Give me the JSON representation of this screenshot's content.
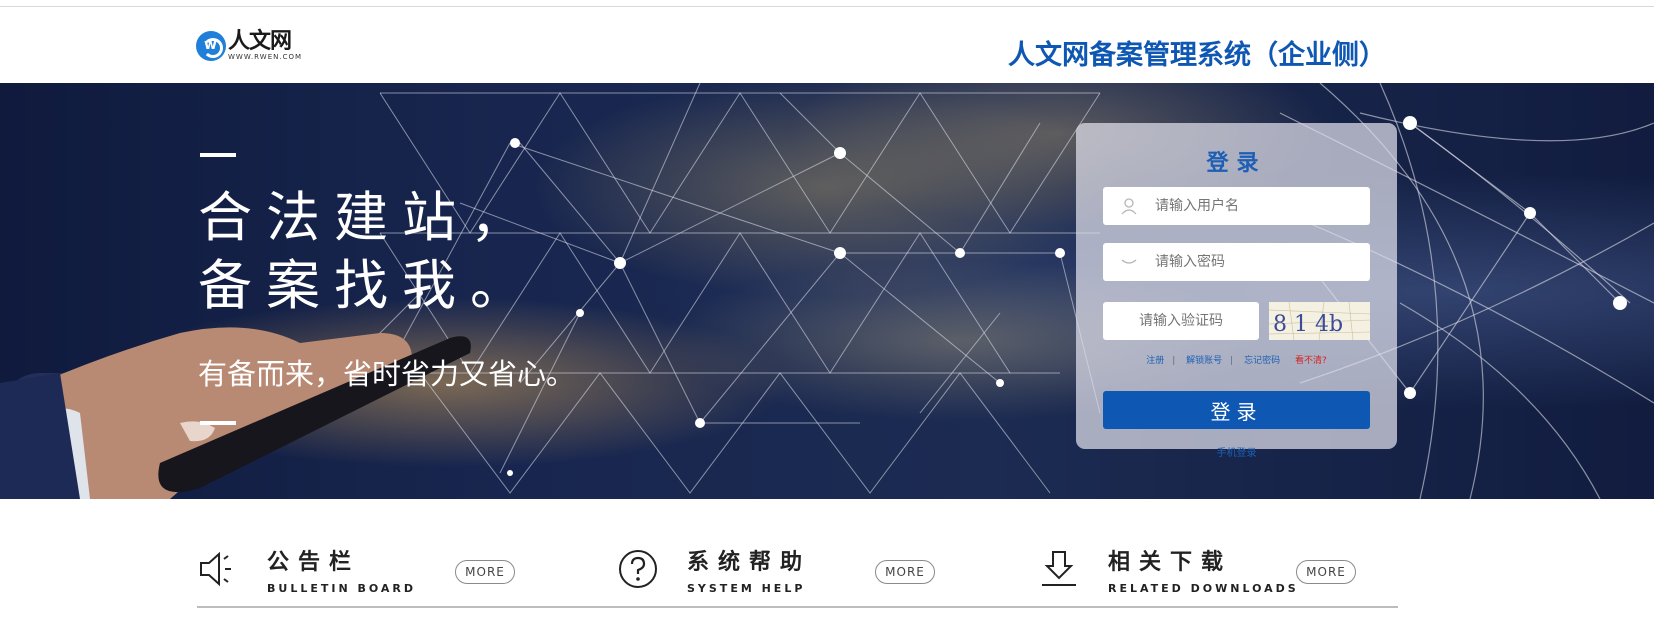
{
  "header": {
    "logo_name": "人文网",
    "logo_url": "WWW.RWEN.COM",
    "site_title": "人文网备案管理系统（企业侧）"
  },
  "banner": {
    "slogan_line1": "合法建站，",
    "slogan_line2": "备案找我。",
    "sub_slogan": "有备而来，省时省力又省心。"
  },
  "login": {
    "title": "登录",
    "username_placeholder": "请输入用户名",
    "password_placeholder": "请输入密码",
    "captcha_placeholder": "请输入验证码",
    "captcha_text": "8 1 4b",
    "links": {
      "register": "注册",
      "unlock": "解锁账号",
      "forgot": "忘记密码",
      "cant_see": "看不清?"
    },
    "submit_label": "登录",
    "mobile_login": "手机登录"
  },
  "sections": [
    {
      "title": "公告栏",
      "subtitle": "BULLETIN BOARD",
      "more": "MORE",
      "icon": "speaker-icon"
    },
    {
      "title": "系统帮助",
      "subtitle": "SYSTEM HELP",
      "more": "MORE",
      "icon": "question-icon"
    },
    {
      "title": "相关下载",
      "subtitle": "RELATED DOWNLOADS",
      "more": "MORE",
      "icon": "download-icon"
    }
  ],
  "colors": {
    "brand_blue": "#0e57b3",
    "link_red": "#d0261e"
  }
}
